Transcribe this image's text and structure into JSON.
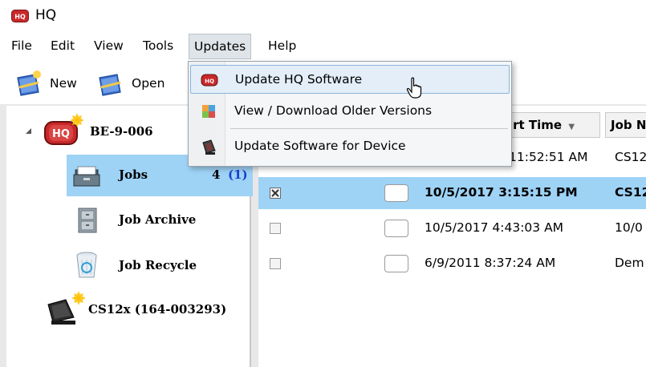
{
  "window": {
    "title": "HQ",
    "app_icon": "hq-logo-icon"
  },
  "menubar": {
    "items": [
      {
        "label": "File"
      },
      {
        "label": "Edit"
      },
      {
        "label": "View"
      },
      {
        "label": "Tools"
      },
      {
        "label": "Updates",
        "active": true
      },
      {
        "label": "Help"
      }
    ]
  },
  "toolbar": {
    "new_label": "New",
    "open_label": "Open"
  },
  "updates_menu": {
    "items": [
      {
        "label": "Update HQ Software",
        "icon": "hq-logo-icon",
        "highlighted": true
      },
      {
        "label": "View / Download Older Versions",
        "icon": "puzzle-icon"
      },
      {
        "label": "Update Software for Device",
        "icon": "device-icon"
      }
    ]
  },
  "tree": {
    "root": {
      "label": "BE-9-006",
      "icon": "hq-logo-icon"
    },
    "children": [
      {
        "label": "Jobs",
        "count": "4",
        "new_count": "(1)",
        "icon": "jobs-folder-icon",
        "selected": true
      },
      {
        "label": "Job Archive",
        "icon": "archive-cabinet-icon"
      },
      {
        "label": "Job Recycle",
        "icon": "recycle-bin-icon"
      }
    ],
    "device": {
      "label": "CS12x (164-003293)",
      "icon": "device-icon"
    }
  },
  "grid": {
    "headers": [
      {
        "label": "art Time",
        "sort": "desc"
      },
      {
        "label": "Job N"
      }
    ],
    "rows": [
      {
        "checked": false,
        "start_time": "11:52:51 AM",
        "job_name": "CS12"
      },
      {
        "checked": true,
        "start_time": "10/5/2017 3:15:15 PM",
        "job_name": "CS12",
        "selected": true
      },
      {
        "checked": false,
        "start_time": "10/5/2017 4:43:03 AM",
        "job_name": "10/0"
      },
      {
        "checked": false,
        "start_time": "6/9/2011 8:37:24 AM",
        "job_name": "Dem"
      }
    ]
  },
  "colors": {
    "selection": "#9ed3f6",
    "menu_hover": "#e3eef9",
    "menu_hover_border": "#8ab4dc",
    "hq_red": "#c8282a",
    "count_blue": "#1a3fd1"
  }
}
